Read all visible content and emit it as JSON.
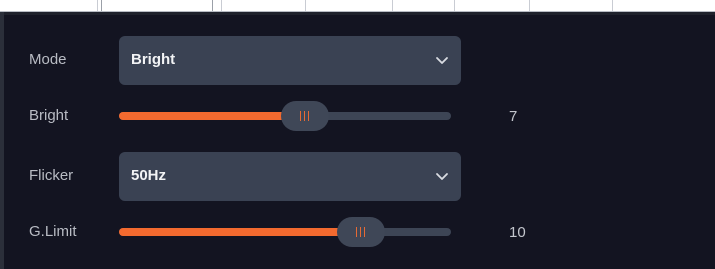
{
  "colors": {
    "panel_bg": "#131421",
    "control_bg": "#3a4253",
    "accent": "#f36a2f",
    "label": "#b9bcc4",
    "value_text": "#f2f3f5"
  },
  "rows": {
    "mode": {
      "label": "Mode",
      "value": "Bright",
      "icon": "chevron-down-icon"
    },
    "bright": {
      "label": "Bright",
      "value": "7",
      "level": 0.56
    },
    "flicker": {
      "label": "Flicker",
      "value": "50Hz",
      "icon": "chevron-down-icon"
    },
    "glimit": {
      "label": "G.Limit",
      "value": "10",
      "level": 0.73
    }
  }
}
